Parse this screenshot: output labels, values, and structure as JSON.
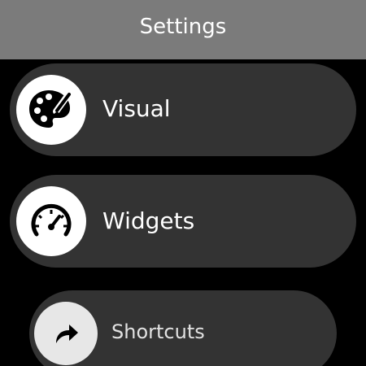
{
  "header": {
    "title": "Settings"
  },
  "menu": {
    "items": [
      {
        "label": "Visual",
        "icon": "palette-icon"
      },
      {
        "label": "Widgets",
        "icon": "speedometer-icon"
      },
      {
        "label": "Shortcuts",
        "icon": "shortcut-arrow-icon"
      }
    ]
  },
  "colors": {
    "header_background": "#7b7b7b",
    "screen_background": "#000000",
    "item_background": "#333333",
    "icon_circle": "#ffffff",
    "icon_circle_dim": "#e7e7e7",
    "text": "#ffffff"
  }
}
